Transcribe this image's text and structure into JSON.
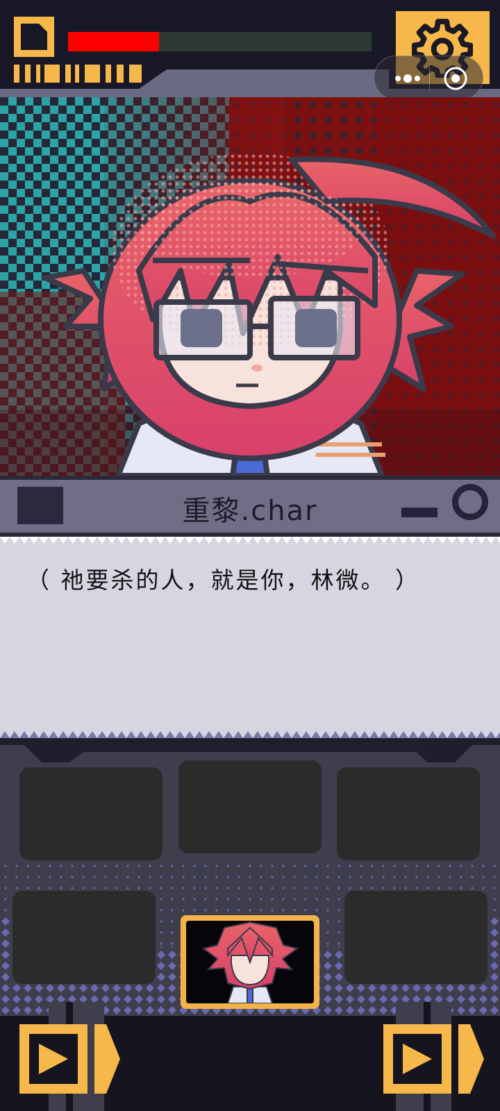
{
  "hud": {
    "hp_fraction": 0.3,
    "file_icon": "file-icon",
    "settings_icon": "gear-icon",
    "menu_icon": "more-dots-icon",
    "close_icon": "target-circle-icon"
  },
  "scene": {
    "character": "red-haired chibi with glasses and tie"
  },
  "dialogue": {
    "speaker": "重黎.char",
    "text": "（ 祂要杀的人，就是你，林微。 ）"
  },
  "colors": {
    "accent": "#f6b84a",
    "hp": "#ff0000",
    "panel": "#3f3e4d",
    "dialogue_bg": "#d6d6e2",
    "name_bar": "#6f6e86"
  },
  "slots": {
    "count": 6,
    "active_slot": "portrait"
  },
  "nav": {
    "left_icon": "play-arrow-icon",
    "right_icon": "play-arrow-icon"
  }
}
